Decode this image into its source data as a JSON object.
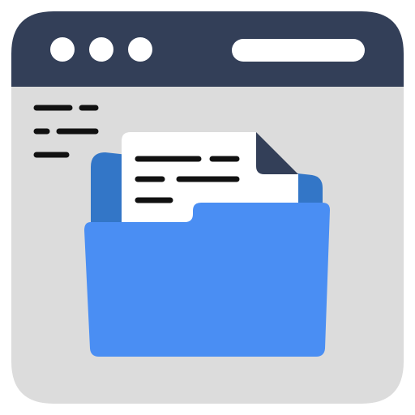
{
  "icon": {
    "name": "browser-window-folder-document-icon",
    "colors": {
      "window_frame": "#333f58",
      "window_body": "#dcdcdc",
      "window_outline": "#ffffff",
      "window_dot": "#ffffff",
      "address_bar": "#ffffff",
      "sidebar_lines": "#111111",
      "folder_back": "#3376c7",
      "folder_front": "#4a8ef3",
      "paper": "#ffffff",
      "paper_fold": "#333f58",
      "paper_lines": "#111111"
    }
  }
}
